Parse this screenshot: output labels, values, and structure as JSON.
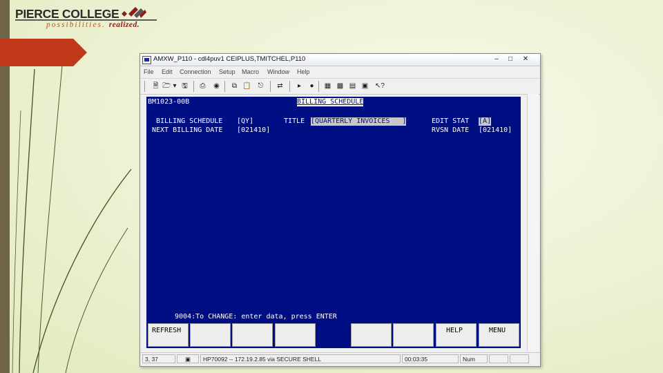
{
  "logo": {
    "main": "PIERCE COLLEGE",
    "tagline": "possibilities.",
    "tagline_bold": "realized."
  },
  "window": {
    "title": "AMXW_P110 - cdl4puv1 CEIPLUS,TMITCHEL,P110",
    "menu": [
      "File",
      "Edit",
      "Connection",
      "Setup",
      "Macro",
      "Window",
      "Help"
    ]
  },
  "terminal": {
    "screen_id": "BM1023-00B",
    "screen_title": "BILLING SCHEDULE",
    "billing_schedule_label": "BILLING SCHEDULE",
    "billing_schedule_value": "[QY]",
    "title_label": "TITLE",
    "title_value": "[QUARTERLY INVOICES   ]",
    "edit_stat_label": "EDIT STAT",
    "edit_stat_value": "[A]",
    "next_billing_label": "NEXT BILLING DATE",
    "next_billing_value": "[021410]",
    "rvsn_label": "RVSN DATE",
    "rvsn_value": "[021410]",
    "message": "9004:To CHANGE: enter data, press ENTER",
    "fkeys": [
      "REFRESH",
      "",
      "",
      "",
      "",
      "",
      "",
      "HELP",
      "MENU"
    ]
  },
  "status": {
    "cursor": "3, 37",
    "host": "HP70092 -- 172.19.2.85 via SECURE SHELL",
    "time": "00:03:35",
    "num": "Num"
  },
  "colors": {
    "terminal_bg": "#000e84",
    "accent_red": "#c0391b",
    "left_bar": "#6e6548"
  }
}
